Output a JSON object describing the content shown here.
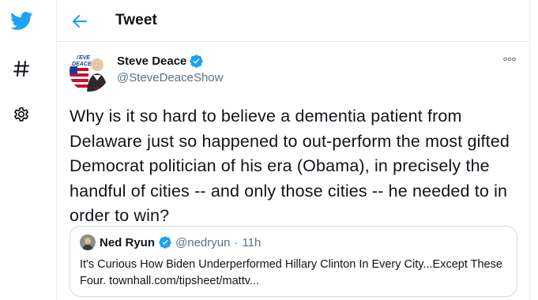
{
  "colors": {
    "accent": "#1da1f2",
    "text": "#0f1419",
    "secondary": "#5b7083",
    "border": "#e6ecf0"
  },
  "sidebar": {
    "items": [
      {
        "icon": "twitter-bird-icon"
      },
      {
        "icon": "hashtag-icon"
      },
      {
        "icon": "gear-icon"
      }
    ]
  },
  "header": {
    "title": "Tweet"
  },
  "tweet": {
    "author": {
      "name": "Steve Deace",
      "handle": "@SteveDeaceShow",
      "verified": true,
      "avatar_text_top": "STEVE",
      "avatar_text_bottom": "DEACE",
      "avatar_brand": "theblaze"
    },
    "text": "Why is it so hard to believe a dementia patient from Delaware just so happened to out-perform the most gifted Democrat politician of his era (Obama), in precisely the handful of cities -- and only those cities -- he needed to in order to win?",
    "quote": {
      "name": "Ned Ryun",
      "handle": "@nedryun",
      "dot": "·",
      "time": "11h",
      "verified": true,
      "text": "It's Curious How Biden Underperformed Hillary Clinton In Every City...Except These Four. townhall.com/tipsheet/mattv..."
    }
  }
}
